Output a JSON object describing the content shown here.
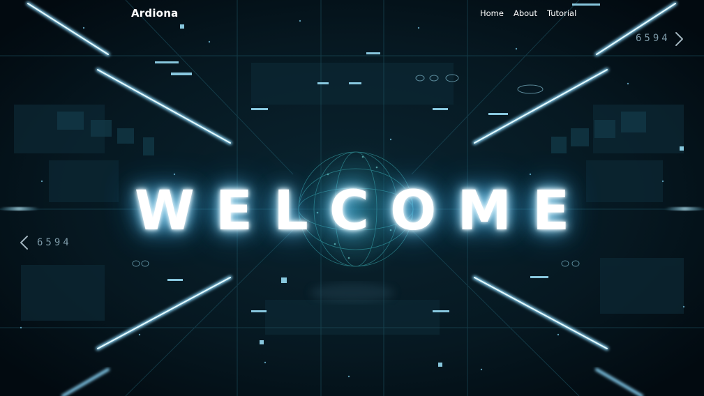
{
  "nav": {
    "brand": "Ardiona",
    "links": [
      {
        "label": "Home"
      },
      {
        "label": "About"
      },
      {
        "label": "Tutorial"
      }
    ]
  },
  "hero": {
    "title": "WELCOME"
  },
  "slider": {
    "counter_right": "6594",
    "counter_left": "6594",
    "next_icon": "chevron-right-icon",
    "prev_icon": "chevron-left-icon"
  },
  "colors": {
    "background": "#04111a",
    "glow": "#6fd0ff",
    "text": "#ffffff"
  }
}
